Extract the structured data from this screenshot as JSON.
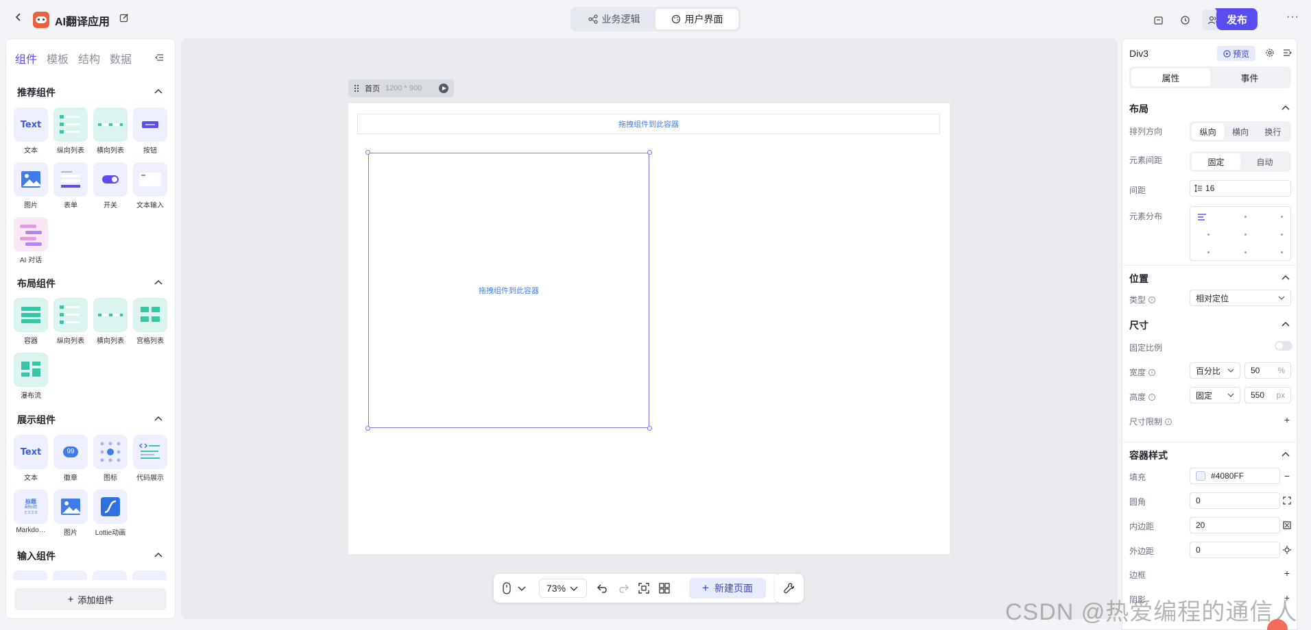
{
  "header": {
    "app_title": "AI翻译应用",
    "mode_tabs": [
      {
        "label": "业务逻辑",
        "active": false
      },
      {
        "label": "用户界面",
        "active": true
      }
    ],
    "publish_label": "发布"
  },
  "left_panel": {
    "tabs": [
      "组件",
      "模板",
      "结构",
      "数据"
    ],
    "sections": [
      {
        "title": "推荐组件",
        "items": [
          "文本",
          "纵向列表",
          "横向列表",
          "按钮",
          "图片",
          "表单",
          "开关",
          "文本输入",
          "AI 对话"
        ]
      },
      {
        "title": "布局组件",
        "items": [
          "容器",
          "纵向列表",
          "横向列表",
          "宫格列表",
          "瀑布流"
        ]
      },
      {
        "title": "展示组件",
        "items": [
          "文本",
          "徽章",
          "图标",
          "代码展示",
          "Markdo…",
          "图片",
          "Lottie动画"
        ]
      },
      {
        "title": "输入组件",
        "items": []
      }
    ],
    "thumb_text": "Text",
    "thumb_badge": "99",
    "thumb_md": [
      "标题",
      "副标题",
      "正文文本"
    ],
    "add_label": "添加组件"
  },
  "canvas": {
    "page_name": "首页",
    "page_size": "1200 * 900",
    "drop_hint_top": "拖拽组件到此容器",
    "drop_hint_box": "拖拽组件到此容器"
  },
  "bottom_bar": {
    "zoom": "73%",
    "new_page_label": "新建页面"
  },
  "right_panel": {
    "element_name": "Div3",
    "preview_label": "预览",
    "tabs": [
      {
        "label": "属性",
        "active": true
      },
      {
        "label": "事件",
        "active": false
      }
    ],
    "layout": {
      "title": "布局",
      "direction_label": "排列方向",
      "direction_options": [
        {
          "label": "纵向",
          "active": true
        },
        {
          "label": "横向",
          "active": false
        },
        {
          "label": "换行",
          "active": false
        }
      ],
      "spacing_mode_label": "元素间距",
      "spacing_mode_options": [
        {
          "label": "固定",
          "active": true
        },
        {
          "label": "自动",
          "active": false
        }
      ],
      "gap_label": "间距",
      "gap_value": "16",
      "distribution_label": "元素分布"
    },
    "position": {
      "title": "位置",
      "type_label": "类型",
      "type_value": "相对定位"
    },
    "size": {
      "title": "尺寸",
      "ratio_label": "固定比例",
      "width_label": "宽度",
      "width_mode": "百分比",
      "width_value": "50",
      "width_unit": "%",
      "height_label": "高度",
      "height_mode": "固定",
      "height_value": "550",
      "height_unit": "px",
      "limit_label": "尺寸限制"
    },
    "container_style": {
      "title": "容器样式",
      "fill_label": "填充",
      "fill_value": "#4080FF",
      "radius_label": "圆角",
      "radius_value": "0",
      "padding_label": "内边距",
      "padding_value": "20",
      "margin_label": "外边距",
      "margin_value": "0",
      "border_label": "边框",
      "shadow_label": "阴影"
    }
  },
  "watermark": "CSDN @热爱编程的通信人",
  "colors": {
    "accent": "#5b4cf0",
    "hint": "#3b82f6",
    "selection": "#7b73f0"
  }
}
